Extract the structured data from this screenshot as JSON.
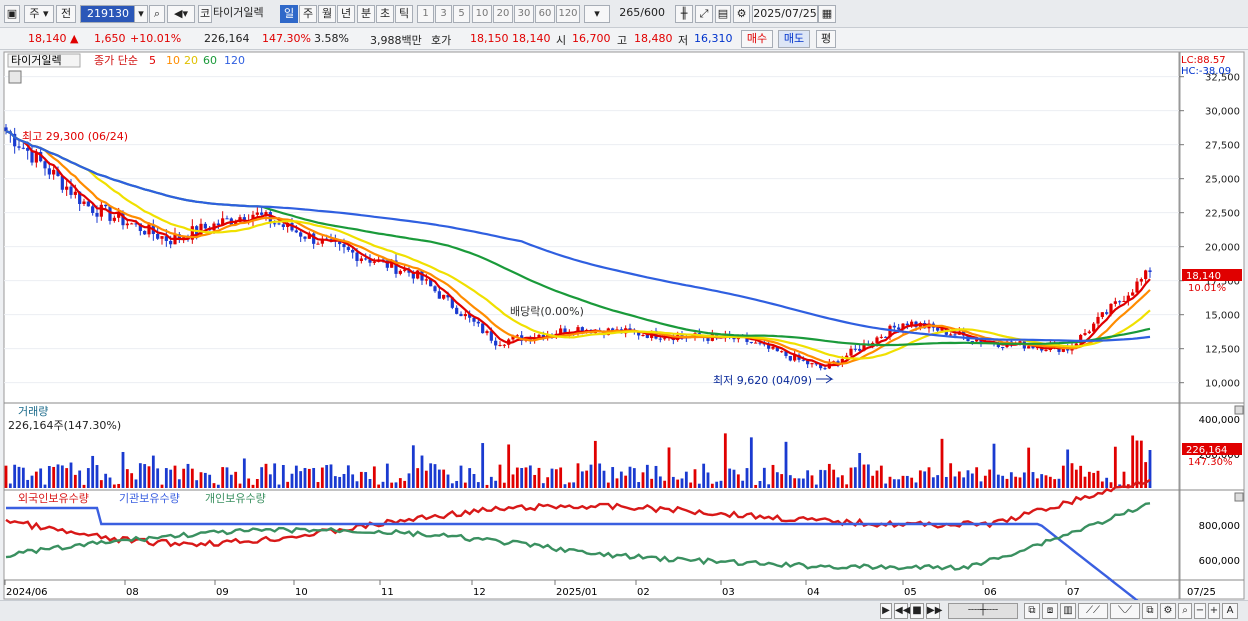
{
  "toolbar": {
    "market": "주",
    "price_type": "전",
    "code": "219130",
    "company": "타이거일렉",
    "periods": [
      "일",
      "주",
      "월",
      "년",
      "분",
      "초",
      "틱"
    ],
    "numbers": [
      "1",
      "3",
      "5",
      "10",
      "20",
      "30",
      "60",
      "120"
    ],
    "count": "265",
    "count_total": "/600",
    "date": "2025/07/25",
    "market_badge": "코"
  },
  "info": {
    "price": "18,140 ▲",
    "change": "1,650",
    "change_pct": "+10.01%",
    "volume": "226,164",
    "vol_ratio": "147.30%",
    "turnover": "3.58%",
    "amount": "3,988백만",
    "hoga_label": "호가",
    "ask": "18,150",
    "bid": "18,140",
    "open_label": "시",
    "open": "16,700",
    "high_label": "고",
    "high": "18,480",
    "low_label": "저",
    "low": "16,310",
    "buy_label": "매수",
    "sell_label": "매도",
    "avg_label": "평"
  },
  "colors": {
    "ma5": "#e00000",
    "ma10": "#ff8c00",
    "ma20": "#f0e000",
    "ma60": "#1a9a3a",
    "ma120": "#2f5fe0",
    "foreign": "#d81818",
    "inst": "#3a5fe0",
    "indiv": "#3a9060"
  },
  "main_panel": {
    "name": "타이거일렉",
    "ma_label": "종가 단순",
    "ma_periods": [
      "5",
      "10",
      "20",
      "60",
      "120"
    ],
    "high_note": "최고 29,300 (06/24)",
    "low_note": "최저 9,620 (04/09)",
    "div_note": "배당락(0.00%)",
    "lc": "LC:88.57",
    "hc": "HC:-38.09",
    "last_price": "18,140",
    "last_pct": "10.01%",
    "y_ticks": [
      "32,500",
      "30,000",
      "27,500",
      "25,000",
      "22,500",
      "20,000",
      "17,500",
      "15,000",
      "12,500",
      "10,000"
    ]
  },
  "volume_panel": {
    "title": "거래량",
    "value_note": "226,164주(147.30%)",
    "last": "226,164",
    "last_pct": "147.30%",
    "y_ticks": [
      "400,000",
      "200,000"
    ]
  },
  "holdings_panel": {
    "legend": [
      "외국인보유수량",
      "기관보유수량",
      "개인보유수량"
    ],
    "y_ticks": [
      "800,000",
      "600,000"
    ]
  },
  "x_axis": [
    "2024/06",
    "08",
    "09",
    "10",
    "11",
    "12",
    "2025/01",
    "02",
    "03",
    "04",
    "05",
    "06",
    "07",
    "07/25"
  ],
  "chart_data": {
    "type": "line",
    "x": [
      "2024/06",
      "2024/07",
      "2024/08",
      "2024/09",
      "2024/10",
      "2024/11",
      "2024/12",
      "2025/01",
      "2025/02",
      "2025/03",
      "2025/04",
      "2025/05",
      "2025/06",
      "2025/07",
      "2025/07/25"
    ],
    "series": [
      {
        "name": "종가",
        "values": [
          28500,
          23000,
          20500,
          22500,
          20000,
          18000,
          13000,
          14000,
          13500,
          13200,
          11000,
          14500,
          13000,
          12500,
          18140
        ]
      }
    ],
    "ylim": [
      8800,
      33800
    ]
  }
}
